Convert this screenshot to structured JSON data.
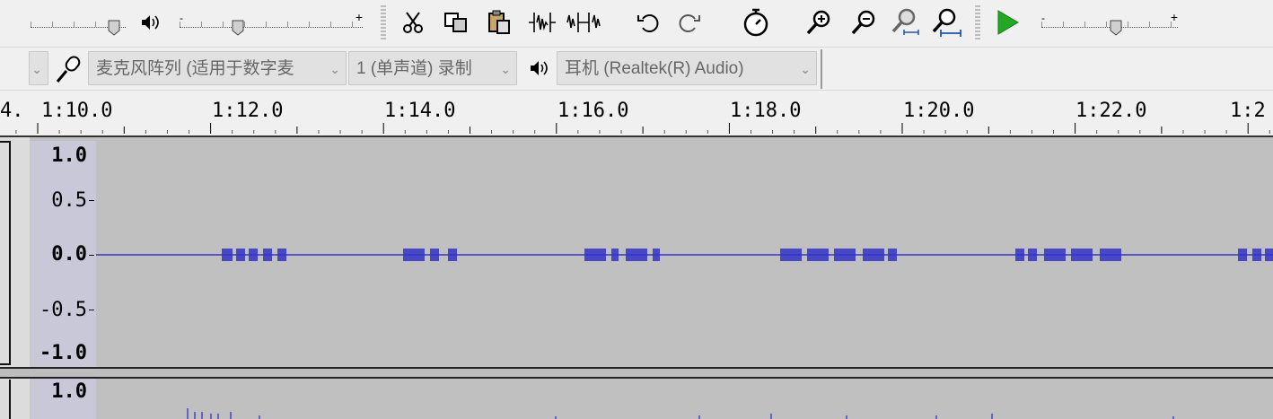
{
  "toolbar": {
    "vol_minus": "-",
    "vol_plus": "+",
    "speed_minus": "-",
    "speed_plus": "+"
  },
  "devices": {
    "mic_device": "麦克风阵列 (适用于数字麦",
    "channels": "1 (单声道) 录制",
    "output_device": "耳机 (Realtek(R) Audio)"
  },
  "ruler": {
    "labels": [
      "4.",
      "1:10.0",
      "1:12.0",
      "1:14.0",
      "1:16.0",
      "1:18.0",
      "1:20.0",
      "1:22.0",
      "1:2"
    ]
  },
  "track1": {
    "vlabels": [
      "1.0",
      "0.5",
      "0.0",
      "-0.5",
      "-1.0"
    ]
  },
  "track2": {
    "vlabels": [
      "1.0"
    ]
  },
  "colors": {
    "wave": "#3232c8",
    "track_bg": "#c0c0c0",
    "play_green": "#22a822"
  }
}
